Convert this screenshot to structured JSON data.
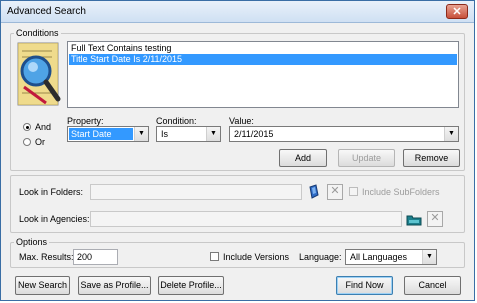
{
  "window": {
    "title": "Advanced Search",
    "close_glyph": "✕"
  },
  "conditions": {
    "legend": "Conditions",
    "list": [
      {
        "text": "Full Text Contains testing",
        "selected": false
      },
      {
        "text": "Title Start Date Is 2/11/2015",
        "selected": true
      }
    ],
    "and_label": "And",
    "or_label": "Or",
    "logic_selected": "And",
    "property_label": "Property:",
    "property_value": "Start Date",
    "condition_label": "Condition:",
    "condition_value": "Is",
    "value_label": "Value:",
    "value_value": "2/11/2015",
    "add_label": "Add",
    "update_label": "Update",
    "remove_label": "Remove",
    "icon": "magnifier-document-icon"
  },
  "folders": {
    "label": "Look in Folders:",
    "value": "",
    "include_subfolders_label": "Include SubFolders",
    "include_subfolders_checked": false
  },
  "agencies": {
    "label": "Look in Agencies:",
    "value": ""
  },
  "options": {
    "legend": "Options",
    "max_results_label": "Max. Results:",
    "max_results_value": "200",
    "include_versions_label": "Include Versions",
    "include_versions_checked": false,
    "language_label": "Language:",
    "language_value": "All Languages"
  },
  "footer": {
    "new_search": "New Search",
    "save_profile": "Save as Profile...",
    "delete_profile": "Delete Profile...",
    "find_now": "Find Now",
    "cancel": "Cancel"
  },
  "colors": {
    "selection": "#3399ff",
    "titlebar": "#cfe0f3",
    "close": "#c7503a"
  }
}
